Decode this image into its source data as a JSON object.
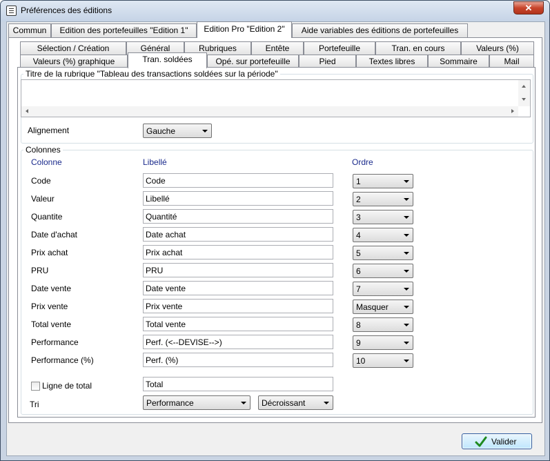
{
  "window": {
    "title": "Préférences des éditions",
    "close_icon": "close-icon",
    "app_icon": "document-list-icon"
  },
  "top_tabs": [
    {
      "label": "Commun",
      "active": false
    },
    {
      "label": "Edition des portefeuilles \"Edition 1\"",
      "active": false
    },
    {
      "label": "Edition Pro \"Edition 2\"",
      "active": true
    },
    {
      "label": "Aide variables des éditions de portefeuilles",
      "active": false
    }
  ],
  "sub_tabs_row1": [
    {
      "label": "Sélection / Création"
    },
    {
      "label": "Général"
    },
    {
      "label": "Rubriques"
    },
    {
      "label": "Entête"
    },
    {
      "label": "Portefeuille"
    },
    {
      "label": "Tran. en cours"
    },
    {
      "label": "Valeurs (%)"
    }
  ],
  "sub_tabs_row2": [
    {
      "label": "Valeurs (%) graphique",
      "active": false
    },
    {
      "label": "Tran. soldées",
      "active": true
    },
    {
      "label": "Opé. sur portefeuille",
      "active": false
    },
    {
      "label": "Pied",
      "active": false
    },
    {
      "label": "Textes libres",
      "active": false
    },
    {
      "label": "Sommaire",
      "active": false
    },
    {
      "label": "Mail",
      "active": false
    }
  ],
  "title_group": {
    "legend": "Titre de la rubrique \"Tableau des transactions soldées sur la période\"",
    "value": "",
    "alignment_label": "Alignement",
    "alignment_value": "Gauche"
  },
  "columns_group": {
    "legend": "Colonnes",
    "headers": {
      "colonne": "Colonne",
      "libelle": "Libellé",
      "ordre": "Ordre"
    },
    "rows": [
      {
        "colonne": "Code",
        "libelle": "Code",
        "ordre": "1"
      },
      {
        "colonne": "Valeur",
        "libelle": "Libellé",
        "ordre": "2"
      },
      {
        "colonne": "Quantite",
        "libelle": "Quantité",
        "ordre": "3"
      },
      {
        "colonne": "Date d'achat",
        "libelle": "Date achat",
        "ordre": "4"
      },
      {
        "colonne": "Prix achat",
        "libelle": "Prix achat",
        "ordre": "5"
      },
      {
        "colonne": "PRU",
        "libelle": "PRU",
        "ordre": "6"
      },
      {
        "colonne": "Date vente",
        "libelle": "Date vente",
        "ordre": "7"
      },
      {
        "colonne": "Prix vente",
        "libelle": "Prix vente",
        "ordre": "Masquer"
      },
      {
        "colonne": "Total vente",
        "libelle": "Total vente",
        "ordre": "8"
      },
      {
        "colonne": "Performance",
        "libelle": "Perf. (<--DEVISE-->)",
        "ordre": "9"
      },
      {
        "colonne": "Performance (%)",
        "libelle": "Perf. (%)",
        "ordre": "10"
      }
    ],
    "total_line": {
      "label": "Ligne de total",
      "checked": false,
      "value": "Total"
    },
    "sort": {
      "label": "Tri",
      "field": "Performance",
      "direction": "Décroissant"
    }
  },
  "buttons": {
    "valider": "Valider",
    "valider_icon": "checkmark-icon"
  }
}
